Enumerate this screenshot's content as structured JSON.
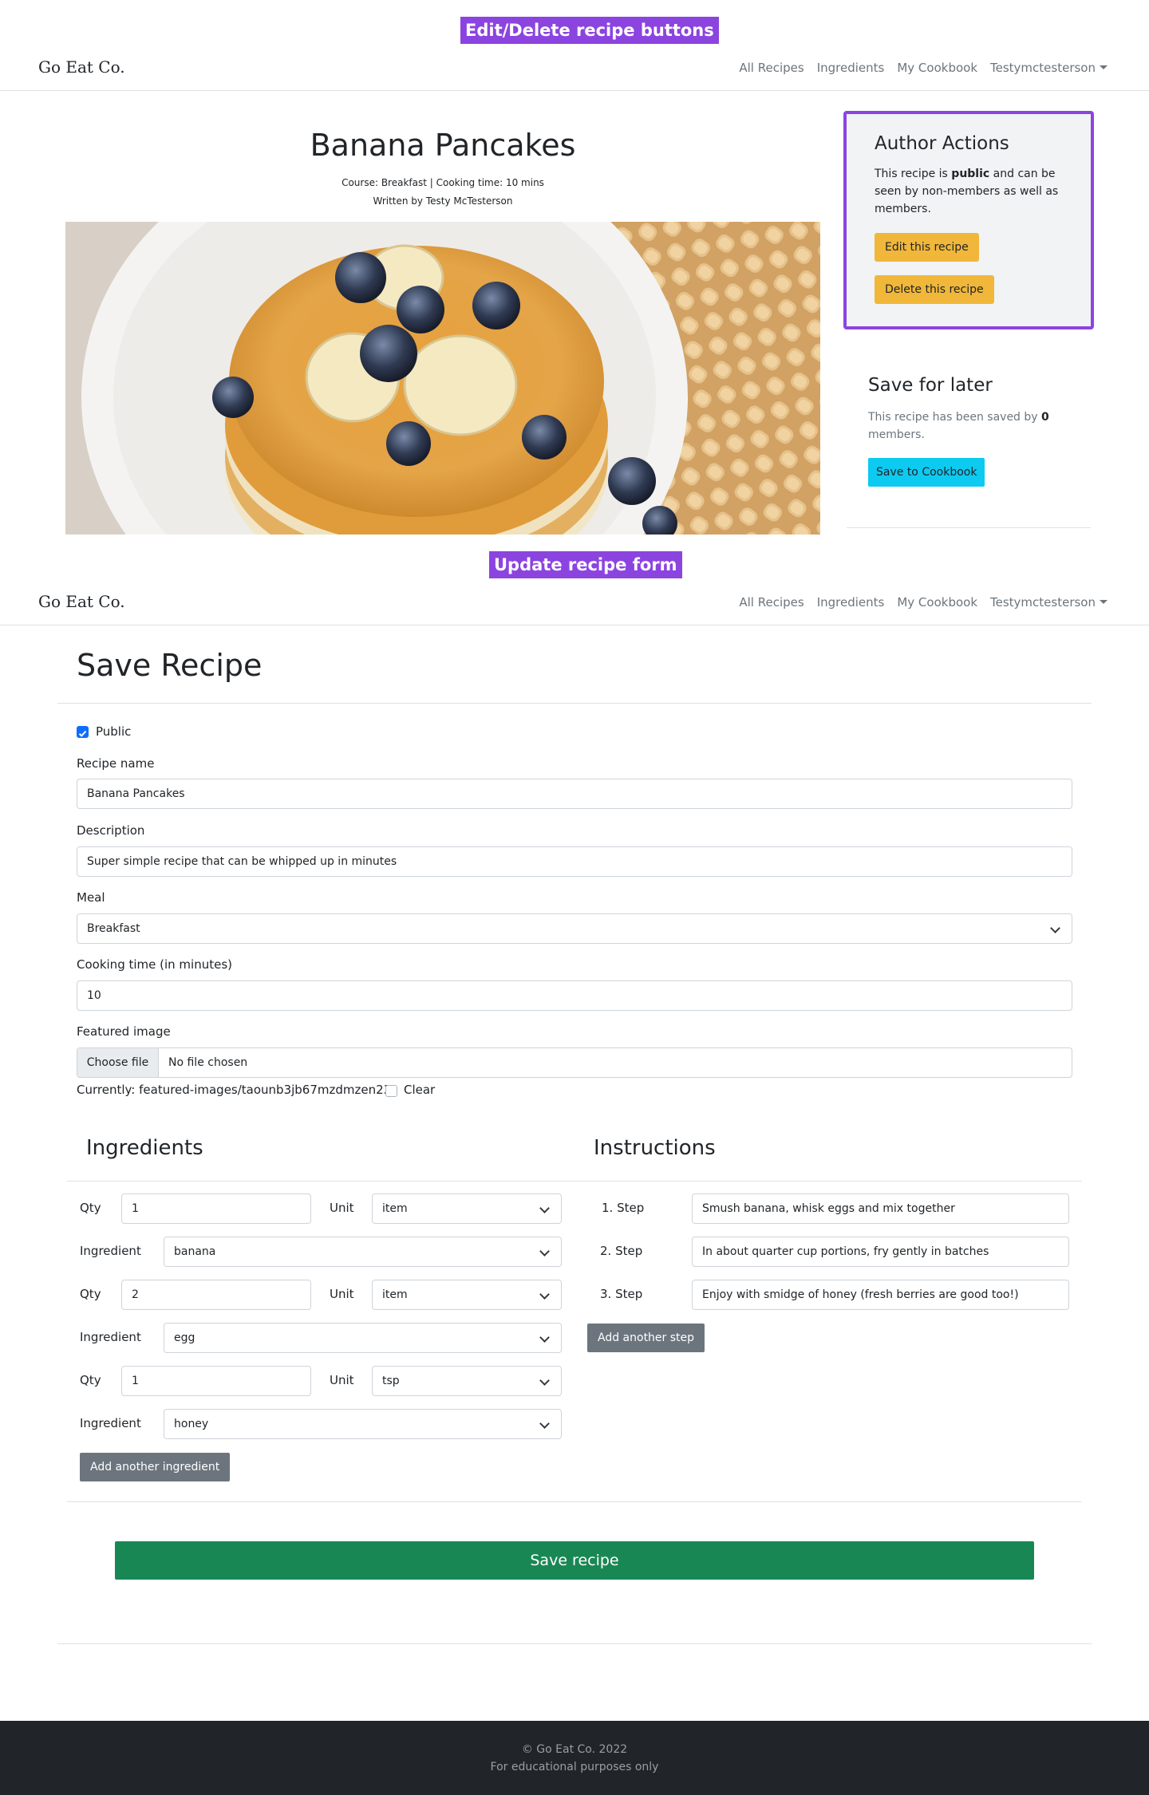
{
  "annotations": {
    "top": "Edit/Delete recipe buttons",
    "middle": "Update recipe form"
  },
  "navbar": {
    "brand": "Go Eat Co.",
    "links": [
      "All Recipes",
      "Ingredients",
      "My Cookbook",
      "Testymctesterson"
    ]
  },
  "recipe": {
    "title": "Banana Pancakes",
    "meta_line1": "Course: Breakfast | Cooking time: 10 mins",
    "meta_line2": "Written by Testy McTesterson",
    "image": "banana pancakes with blueberries"
  },
  "author_actions": {
    "heading": "Author Actions",
    "text_before": "This recipe is ",
    "text_bold": "public",
    "text_after": " and can be seen by non-members as well as members.",
    "edit_label": "Edit this recipe",
    "delete_label": "Delete this recipe"
  },
  "save_later": {
    "heading": "Save for later",
    "text_before": "This recipe has been saved by ",
    "count": "0",
    "text_after": " members.",
    "button_label": "Save to Cookbook"
  },
  "form": {
    "title": "Save Recipe",
    "public_label": "Public",
    "public_checked": true,
    "name_label": "Recipe name",
    "name_value": "Banana Pancakes",
    "description_label": "Description",
    "description_value": "Super simple recipe that can be whipped up in minutes",
    "meal_label": "Meal",
    "meal_value": "Breakfast",
    "cooking_time_label": "Cooking time (in minutes)",
    "cooking_time_value": "10",
    "image_label": "Featured image",
    "choose_file": "Choose file",
    "no_file": "No file chosen",
    "currently": "Currently: featured-images/taounb3jb67mzdmzen23",
    "clear_label": "Clear"
  },
  "ingredients": {
    "heading": "Ingredients",
    "qty_label": "Qty",
    "unit_label": "Unit",
    "ingredient_label": "Ingredient",
    "rows": [
      {
        "qty": "1",
        "unit": "item",
        "ingredient": "banana"
      },
      {
        "qty": "2",
        "unit": "item",
        "ingredient": "egg"
      },
      {
        "qty": "1",
        "unit": "tsp",
        "ingredient": "honey"
      }
    ],
    "add_label": "Add another ingredient"
  },
  "instructions": {
    "heading": "Instructions",
    "steps": [
      {
        "label": "1. Step",
        "text": "Smush banana, whisk eggs and mix together"
      },
      {
        "label": "2. Step",
        "text": "In about quarter cup portions, fry gently in batches"
      },
      {
        "label": "3. Step",
        "text": "Enjoy with smidge of honey (fresh berries are good too!)"
      }
    ],
    "add_label": "Add another step"
  },
  "save_button": "Save recipe",
  "footer": {
    "line1": "© Go Eat Co. 2022",
    "line2": "For educational purposes only"
  },
  "colors": {
    "annotation": "#8c44e0",
    "warning": "#f0b73a",
    "info": "#0dcaf0",
    "secondary": "#6c757d",
    "success": "#198754",
    "footer": "#212529"
  }
}
